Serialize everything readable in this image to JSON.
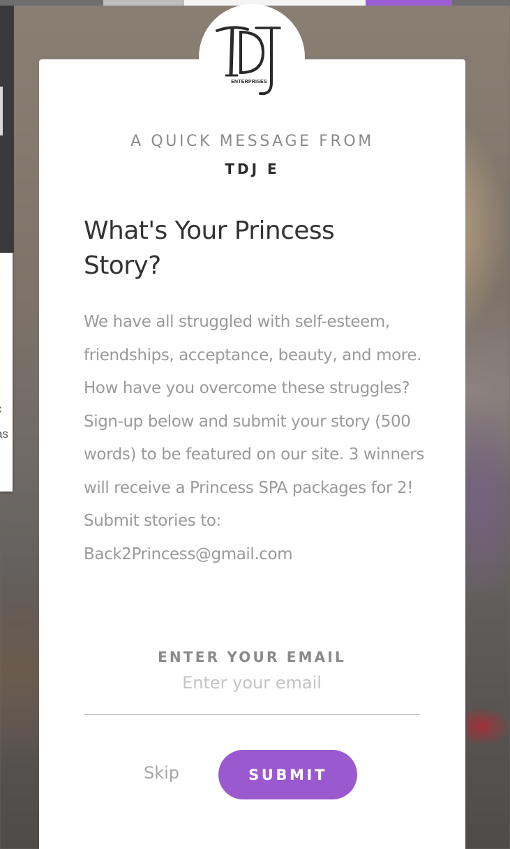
{
  "background": {
    "peek_lines": [
      "c",
      "as"
    ],
    "accent_color": "#9b5ed6"
  },
  "modal": {
    "logo": {
      "monogram": "TDJ",
      "subtitle": "ENTERPRISES"
    },
    "kicker": "A QUICK MESSAGE FROM",
    "sender": "TDJ E",
    "headline": "What's Your Princess Story?",
    "body": "We have all struggled with self-esteem, friendships, acceptance, beauty, and more. How have you overcome these struggles? Sign-up below and submit your story (500 words) to be featured on our site. 3 winners will receive a Princess SPA packages for 2! Submit stories to: Back2Princess@gmail.com",
    "email": {
      "label": "ENTER YOUR EMAIL",
      "placeholder": "Enter your email",
      "value": ""
    },
    "skip_label": "Skip",
    "submit_label": "SUBMIT",
    "submit_color": "#9b59d0"
  }
}
